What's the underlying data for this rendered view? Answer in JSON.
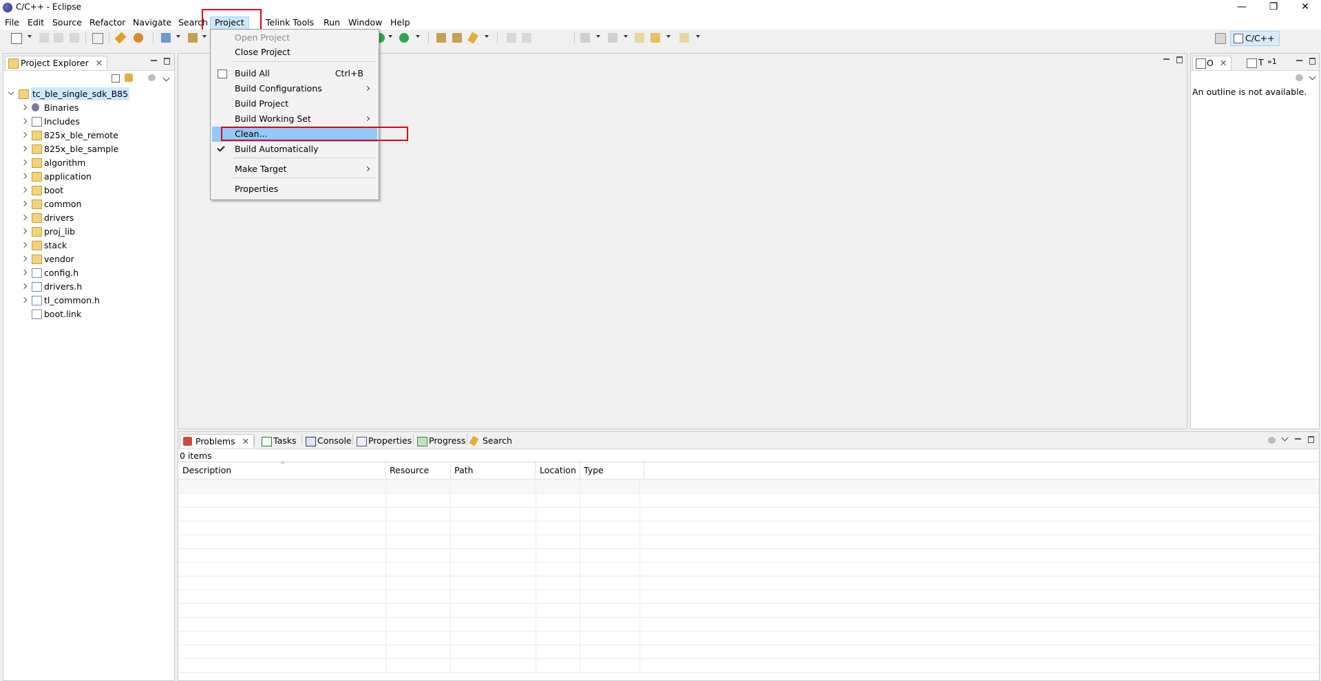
{
  "window": {
    "title": "C/C++ - Eclipse",
    "minimize": "—",
    "restore": "❐",
    "close": "✕"
  },
  "menubar": {
    "items": [
      "File",
      "Edit",
      "Source",
      "Refactor",
      "Navigate",
      "Search",
      "Project",
      "Telink Tools",
      "Run",
      "Window",
      "Help"
    ],
    "active": "Project"
  },
  "project_menu": {
    "items": [
      {
        "label": "Open Project",
        "disabled": true
      },
      {
        "label": "Close Project"
      },
      {
        "label": "Build All",
        "accelerator": "Ctrl+B"
      },
      {
        "label": "Build Configurations",
        "submenu": true
      },
      {
        "label": "Build Project"
      },
      {
        "label": "Build Working Set",
        "submenu": true
      },
      {
        "label": "Clean...",
        "highlighted": true
      },
      {
        "label": "Build Automatically",
        "checked": true
      },
      {
        "label": "Make Target",
        "submenu": true
      },
      {
        "label": "Properties"
      }
    ]
  },
  "project_explorer": {
    "tab_label": "Project Explorer",
    "root": "tc_ble_single_sdk_B85",
    "items": [
      {
        "label": "Binaries",
        "icon": "binaries-icon"
      },
      {
        "label": "Includes",
        "icon": "includes-icon"
      },
      {
        "label": "825x_ble_remote",
        "icon": "folder-icon"
      },
      {
        "label": "825x_ble_sample",
        "icon": "folder-icon"
      },
      {
        "label": "algorithm",
        "icon": "folder-icon"
      },
      {
        "label": "application",
        "icon": "folder-icon"
      },
      {
        "label": "boot",
        "icon": "folder-icon"
      },
      {
        "label": "common",
        "icon": "folder-icon"
      },
      {
        "label": "drivers",
        "icon": "folder-icon"
      },
      {
        "label": "proj_lib",
        "icon": "folder-icon"
      },
      {
        "label": "stack",
        "icon": "folder-icon"
      },
      {
        "label": "vendor",
        "icon": "folder-icon"
      },
      {
        "label": "config.h",
        "icon": "header-file-icon"
      },
      {
        "label": "drivers.h",
        "icon": "header-file-icon"
      },
      {
        "label": "tl_common.h",
        "icon": "header-file-icon"
      },
      {
        "label": "boot.link",
        "icon": "file-icon"
      }
    ]
  },
  "outline": {
    "tabs": [
      "O",
      "T",
      "»1"
    ],
    "message": "An outline is not available."
  },
  "perspective": {
    "label": "C/C++"
  },
  "bottom_panel": {
    "tabs": [
      "Problems",
      "Tasks",
      "Console",
      "Properties",
      "Progress",
      "Search"
    ],
    "count": "0 items",
    "columns": [
      "Description",
      "Resource",
      "Path",
      "Location",
      "Type"
    ]
  }
}
